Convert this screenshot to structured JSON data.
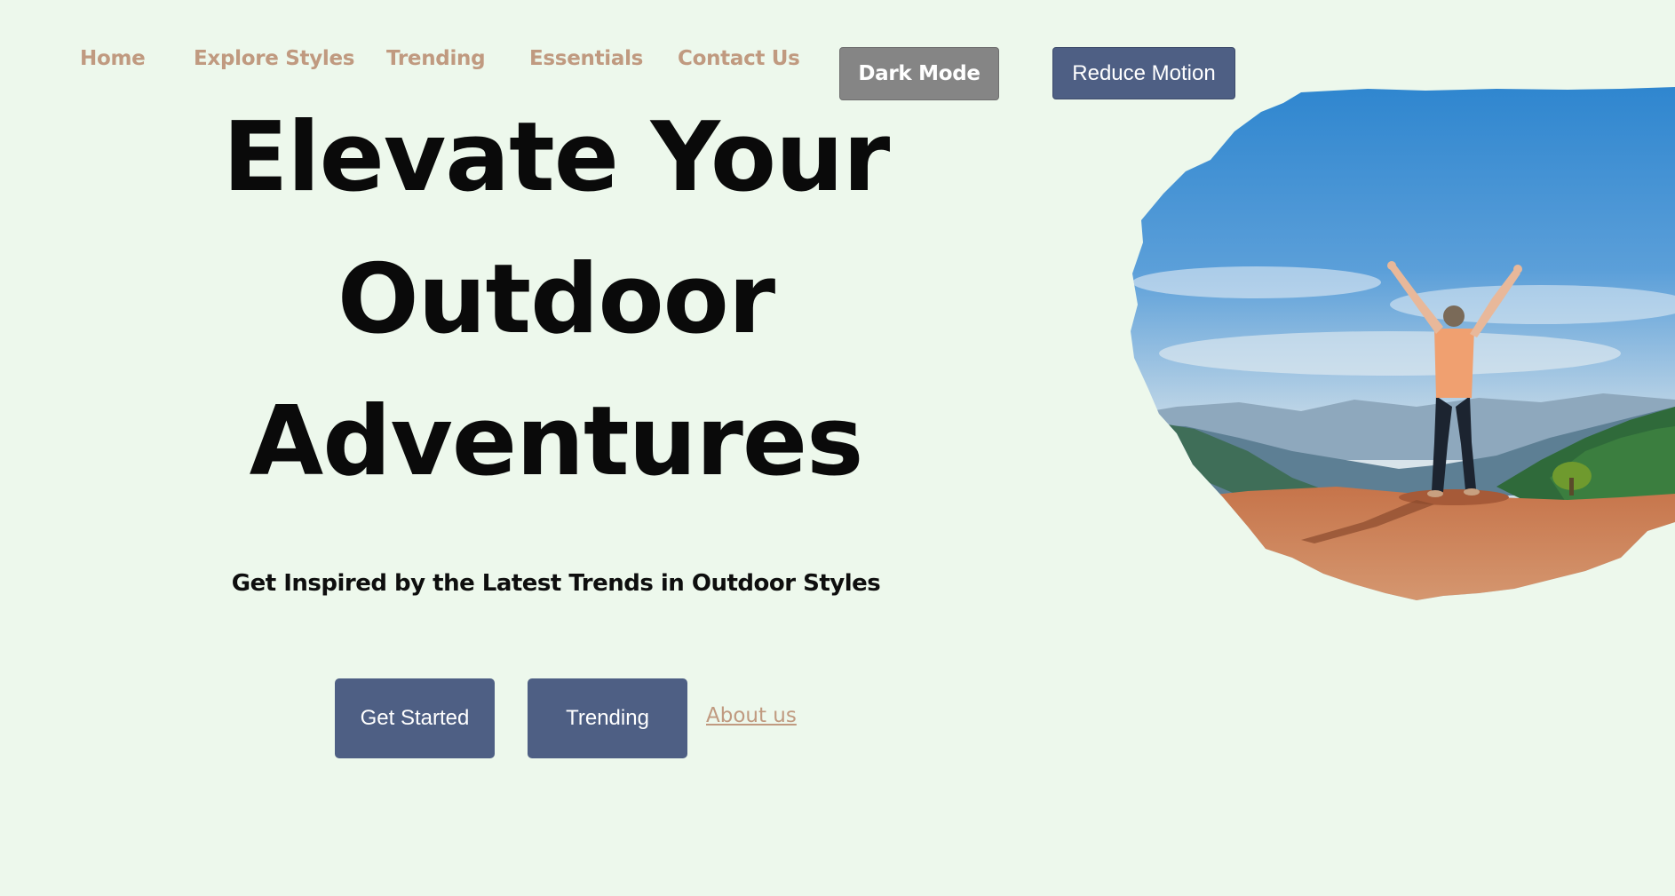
{
  "nav": {
    "links": [
      "Home",
      "Explore Styles",
      "Trending",
      "Essentials",
      "Contact Us"
    ],
    "dark_mode_label": "Dark Mode",
    "reduce_motion_label": "Reduce Motion"
  },
  "hero": {
    "title_lines": [
      "Elevate Your",
      "Outdoor",
      "Adventures"
    ],
    "subtitle": "Get Inspired by the Latest Trends in Outdoor Styles",
    "buttons": [
      "Get Started",
      "Trending"
    ],
    "about_link": "About us"
  },
  "colors": {
    "background": "#edf8ec",
    "nav_link": "#c09a80",
    "primary_button": "#4e5f84",
    "dark_mode_button": "#858585"
  },
  "image": {
    "subject": "hiker-with-raised-arms-on-mountain-summit"
  }
}
